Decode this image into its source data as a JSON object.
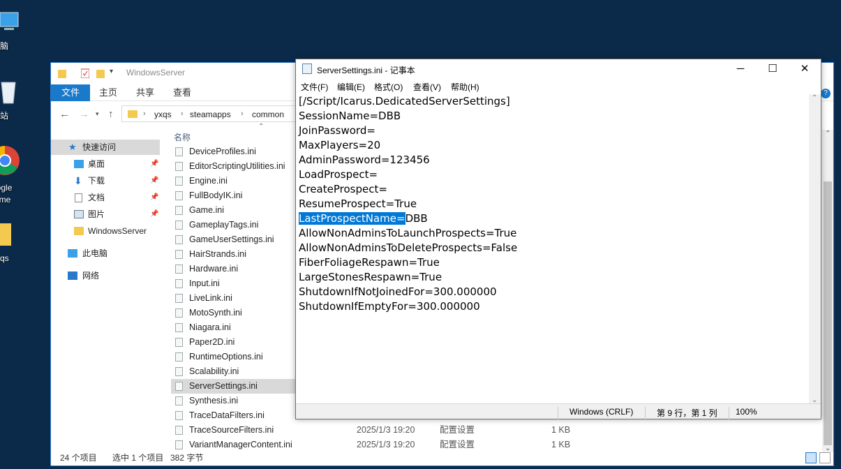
{
  "desktop": {
    "icons": [
      {
        "label": "电脑",
        "icon": "this-pc-icon"
      },
      {
        "label": "收站",
        "icon": "recycle-bin-icon"
      },
      {
        "label": "oogle",
        "label2": "rome",
        "icon": "chrome-icon"
      },
      {
        "label": "yxqs",
        "icon": "folder-icon"
      }
    ]
  },
  "explorer": {
    "title": "WindowsServer",
    "ribbon_tabs": [
      "文件",
      "主页",
      "共享",
      "查看"
    ],
    "breadcrumb": [
      "yxqs",
      "steamapps",
      "common"
    ],
    "column_name": "名称",
    "nav": [
      {
        "label": "快速访问",
        "icon": "star-icon"
      },
      {
        "label": "桌面",
        "icon": "desktop-icon",
        "pinned": true
      },
      {
        "label": "下载",
        "icon": "download-icon",
        "pinned": true
      },
      {
        "label": "文档",
        "icon": "documents-icon",
        "pinned": true
      },
      {
        "label": "图片",
        "icon": "pictures-icon",
        "pinned": true
      },
      {
        "label": "WindowsServer",
        "icon": "folder-icon"
      },
      {
        "label": "此电脑",
        "icon": "this-pc-icon"
      },
      {
        "label": "网络",
        "icon": "network-icon"
      }
    ],
    "files": [
      {
        "name": "DeviceProfiles.ini",
        "date": "",
        "type": "",
        "size": ""
      },
      {
        "name": "EditorScriptingUtilities.ini",
        "date": "",
        "type": "",
        "size": ""
      },
      {
        "name": "Engine.ini",
        "date": "",
        "type": "",
        "size": ""
      },
      {
        "name": "FullBodyIK.ini",
        "date": "",
        "type": "",
        "size": ""
      },
      {
        "name": "Game.ini",
        "date": "",
        "type": "",
        "size": ""
      },
      {
        "name": "GameplayTags.ini",
        "date": "",
        "type": "",
        "size": ""
      },
      {
        "name": "GameUserSettings.ini",
        "date": "",
        "type": "",
        "size": ""
      },
      {
        "name": "HairStrands.ini",
        "date": "",
        "type": "",
        "size": ""
      },
      {
        "name": "Hardware.ini",
        "date": "",
        "type": "",
        "size": ""
      },
      {
        "name": "Input.ini",
        "date": "",
        "type": "",
        "size": ""
      },
      {
        "name": "LiveLink.ini",
        "date": "",
        "type": "",
        "size": ""
      },
      {
        "name": "MotoSynth.ini",
        "date": "",
        "type": "",
        "size": ""
      },
      {
        "name": "Niagara.ini",
        "date": "",
        "type": "",
        "size": ""
      },
      {
        "name": "Paper2D.ini",
        "date": "",
        "type": "",
        "size": ""
      },
      {
        "name": "RuntimeOptions.ini",
        "date": "",
        "type": "",
        "size": ""
      },
      {
        "name": "Scalability.ini",
        "date": "",
        "type": "",
        "size": ""
      },
      {
        "name": "ServerSettings.ini",
        "date": "",
        "type": "",
        "size": "",
        "selected": true
      },
      {
        "name": "Synthesis.ini",
        "date": "",
        "type": "",
        "size": ""
      },
      {
        "name": "TraceDataFilters.ini",
        "date": "",
        "type": "",
        "size": ""
      },
      {
        "name": "TraceSourceFilters.ini",
        "date": "2025/1/3 19:20",
        "type": "配置设置",
        "size": "1 KB"
      },
      {
        "name": "VariantManagerContent.ini",
        "date": "2025/1/3 19:20",
        "type": "配置设置",
        "size": "1 KB"
      }
    ],
    "status": {
      "count": "24 个项目",
      "selected": "选中 1 个项目",
      "size": "382 字节"
    }
  },
  "notepad": {
    "title": "ServerSettings.ini - 记事本",
    "menu": [
      "文件(F)",
      "编辑(E)",
      "格式(O)",
      "查看(V)",
      "帮助(H)"
    ],
    "lines": [
      "[/Script/Icarus.DedicatedServerSettings]",
      "SessionName=DBB",
      "JoinPassword=",
      "MaxPlayers=20",
      "AdminPassword=123456",
      "LoadProspect=",
      "CreateProspect=",
      "ResumeProspect=True",
      "",
      "AllowNonAdminsToLaunchProspects=True",
      "AllowNonAdminsToDeleteProspects=False",
      "FiberFoliageRespawn=True",
      "LargeStonesRespawn=True",
      "ShutdownIfNotJoinedFor=300.000000",
      "ShutdownIfEmptyFor=300.000000"
    ],
    "highlight_line": {
      "selected": "LastProspectName=",
      "rest": "DBB"
    },
    "status": {
      "eol": "Windows (CRLF)",
      "position": "第 9 行，第 1 列",
      "zoom": "100%"
    },
    "window_buttons": {
      "minimize": "─",
      "maximize": "☐",
      "close": "✕"
    }
  },
  "colors": {
    "accent": "#1979ca",
    "selection": "#0078d7",
    "desktop": "#0b2a4a"
  }
}
